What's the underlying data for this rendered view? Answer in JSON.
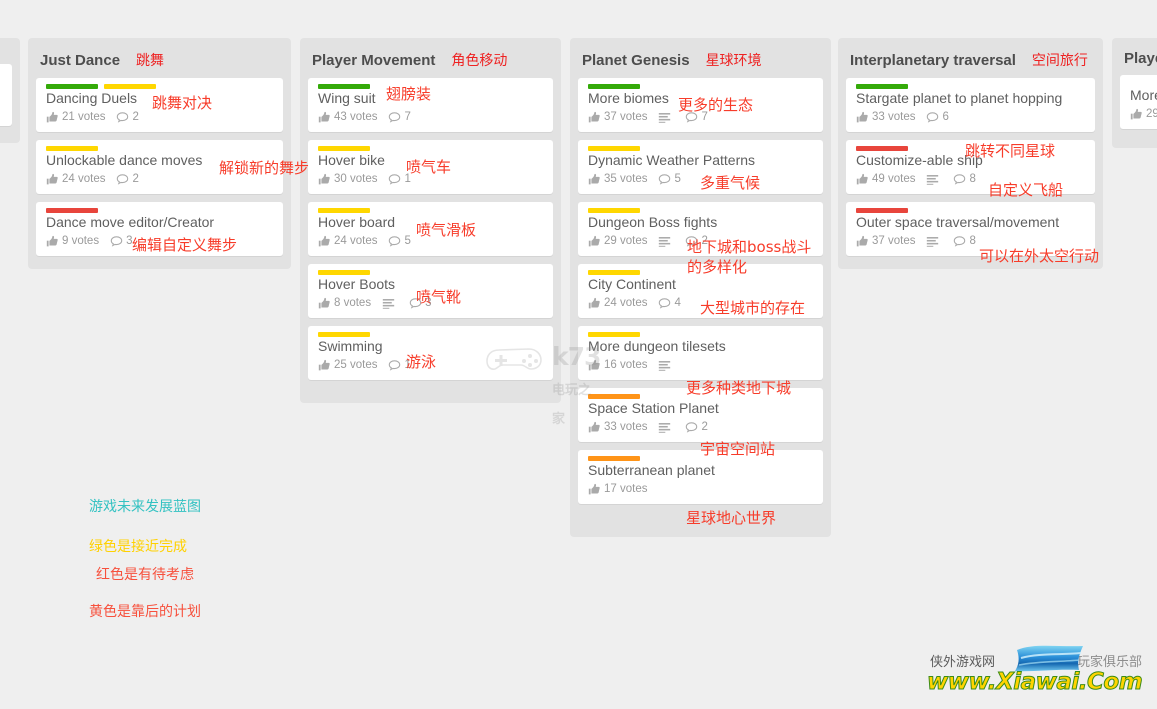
{
  "page": {
    "background": "#efefef",
    "column_background": "#e2e2e2",
    "card_background": "#ffffff"
  },
  "label_colors": {
    "green": "#34aa09",
    "yellow": "#ffd700",
    "orange": "#ff9418",
    "red": "#e8453c",
    "annotation_red": "#f73c2a",
    "legend_teal": "#33c2c2"
  },
  "votes_suffix": "votes",
  "columns": [
    {
      "id": "col-left-partial",
      "title": "",
      "title_cn": "",
      "cards": [
        {
          "title": "",
          "votes": "",
          "comments": "",
          "bars": [],
          "has_desc": false
        }
      ]
    },
    {
      "id": "col-just-dance",
      "title": "Just Dance",
      "title_cn": "跳舞",
      "cards": [
        {
          "title": "Dancing Duels",
          "votes": "21 votes",
          "comments": "2",
          "bars": [
            "green",
            "yellow"
          ],
          "has_desc": false
        },
        {
          "title": "Unlockable dance moves",
          "votes": "24 votes",
          "comments": "2",
          "bars": [
            "yellow"
          ],
          "has_desc": false
        },
        {
          "title": "Dance move editor/Creator",
          "votes": "9 votes",
          "comments": "3",
          "bars": [
            "red"
          ],
          "has_desc": false
        }
      ]
    },
    {
      "id": "col-player-movement",
      "title": "Player Movement",
      "title_cn": "角色移动",
      "cards": [
        {
          "title": "Wing suit",
          "votes": "43 votes",
          "comments": "7",
          "bars": [
            "green"
          ],
          "has_desc": false
        },
        {
          "title": "Hover bike",
          "votes": "30 votes",
          "comments": "1",
          "bars": [
            "yellow"
          ],
          "has_desc": false
        },
        {
          "title": "Hover board",
          "votes": "24 votes",
          "comments": "5",
          "bars": [
            "yellow"
          ],
          "has_desc": false
        },
        {
          "title": "Hover Boots",
          "votes": "8 votes",
          "comments": "3",
          "bars": [
            "yellow"
          ],
          "has_desc": true
        },
        {
          "title": "Swimming",
          "votes": "25 votes",
          "comments": "1",
          "bars": [
            "yellow"
          ],
          "has_desc": false
        }
      ]
    },
    {
      "id": "col-planet-genesis",
      "title": "Planet Genesis",
      "title_cn": "星球环境",
      "cards": [
        {
          "title": "More biomes",
          "votes": "37 votes",
          "comments": "7",
          "bars": [
            "green"
          ],
          "has_desc": true
        },
        {
          "title": "Dynamic Weather Patterns",
          "votes": "35 votes",
          "comments": "5",
          "bars": [
            "yellow"
          ],
          "has_desc": false
        },
        {
          "title": "Dungeon Boss fights",
          "votes": "29 votes",
          "comments": "2",
          "bars": [
            "yellow"
          ],
          "has_desc": true
        },
        {
          "title": "City Continent",
          "votes": "24 votes",
          "comments": "4",
          "bars": [
            "yellow"
          ],
          "has_desc": false
        },
        {
          "title": "More dungeon tilesets",
          "votes": "16 votes",
          "comments": "",
          "bars": [
            "yellow"
          ],
          "has_desc": true
        },
        {
          "title": "Space Station Planet",
          "votes": "33 votes",
          "comments": "2",
          "bars": [
            "orange"
          ],
          "has_desc": true
        },
        {
          "title": "Subterranean planet",
          "votes": "17 votes",
          "comments": "",
          "bars": [
            "orange"
          ],
          "has_desc": false
        }
      ]
    },
    {
      "id": "col-interplanetary-traversal",
      "title": "Interplanetary traversal",
      "title_cn": "空间旅行",
      "cards": [
        {
          "title": "Stargate planet to planet hopping",
          "votes": "33 votes",
          "comments": "6",
          "bars": [
            "green"
          ],
          "has_desc": false
        },
        {
          "title": "Customize-able ship",
          "votes": "49 votes",
          "comments": "8",
          "bars": [
            "red"
          ],
          "has_desc": true
        },
        {
          "title": "Outer space traversal/movement",
          "votes": "37 votes",
          "comments": "8",
          "bars": [
            "red"
          ],
          "has_desc": true
        }
      ]
    },
    {
      "id": "col-right-partial",
      "title": "Playe",
      "title_cn": "",
      "cards": [
        {
          "title": "More",
          "votes": "29",
          "comments": "",
          "bars": [],
          "has_desc": false
        }
      ]
    }
  ],
  "annotations": [
    {
      "id": "anno-dancing-duels",
      "text": "跳舞对决"
    },
    {
      "id": "anno-unlockable",
      "text": "解锁新的舞步"
    },
    {
      "id": "anno-dance-editor",
      "text": "编辑自定义舞步"
    },
    {
      "id": "anno-wing-suit",
      "text": "翅膀装"
    },
    {
      "id": "anno-hover-bike",
      "text": "喷气车"
    },
    {
      "id": "anno-hover-board",
      "text": "喷气滑板"
    },
    {
      "id": "anno-hover-boots",
      "text": "喷气靴"
    },
    {
      "id": "anno-swimming",
      "text": "游泳"
    },
    {
      "id": "anno-more-biomes",
      "text": "更多的生态"
    },
    {
      "id": "anno-weather",
      "text": "多重气候"
    },
    {
      "id": "anno-dungeon-boss",
      "text": "地下城和boss战斗\n的多样化"
    },
    {
      "id": "anno-city-continent",
      "text": "大型城市的存在"
    },
    {
      "id": "anno-tilesets",
      "text": "更多种类地下城"
    },
    {
      "id": "anno-space-station",
      "text": "宇宙空间站"
    },
    {
      "id": "anno-subterranean",
      "text": "星球地心世界"
    },
    {
      "id": "anno-stargate",
      "text": "跳转不同星球"
    },
    {
      "id": "anno-custom-ship",
      "text": "自定义飞船"
    },
    {
      "id": "anno-outer-space",
      "text": "可以在外太空行动"
    }
  ],
  "legend": {
    "title": "游戏未来发展蓝图",
    "green_line": "绿色是接近完成",
    "red_line": "红色是有待考虑",
    "yellow_line": "黄色是靠后的计划"
  },
  "watermarks": {
    "center": "k73",
    "center_cn": "电玩之家",
    "bottom_left_cn": "侠外游戏网",
    "bottom_right_cn": "玩家俱乐部",
    "bottom_url": "www.Xiawai.Com"
  }
}
